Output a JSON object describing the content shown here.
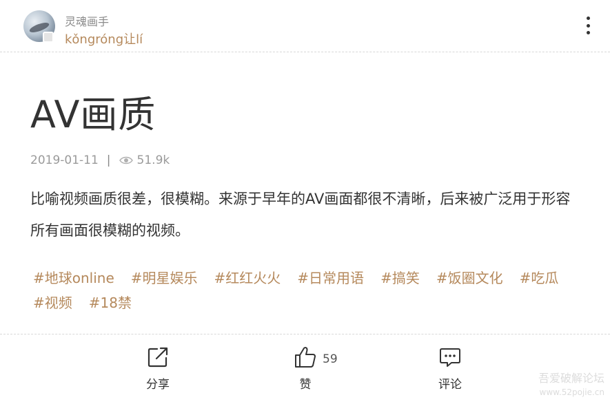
{
  "header": {
    "brand": "灵魂画手",
    "pinyin": "kǒngróng让lí",
    "avatar_icon": "avatar-image",
    "more_icon": "vertical-ellipsis-icon"
  },
  "article": {
    "title": "AV画质",
    "date": "2019-01-11",
    "separator": "|",
    "views": "51.9k",
    "description": "比喻视频画质很差，很模糊。来源于早年的AV画面都很不清晰，后来被广泛用于形容所有画面很模糊的视频。",
    "tags": [
      "#地球online",
      "#明星娱乐",
      "#红红火火",
      "#日常用语",
      "#搞笑",
      "#饭圈文化",
      "#吃瓜",
      "#视频",
      "#18禁"
    ]
  },
  "actions": {
    "share_label": "分享",
    "like_label": "赞",
    "like_count": "59",
    "comment_label": "评论"
  },
  "watermark": {
    "line1": "吾爱破解论坛",
    "line2": "www.52pojie.cn"
  },
  "colors": {
    "accent": "#b5895c",
    "text": "#333333",
    "muted": "#9a9a9a"
  }
}
